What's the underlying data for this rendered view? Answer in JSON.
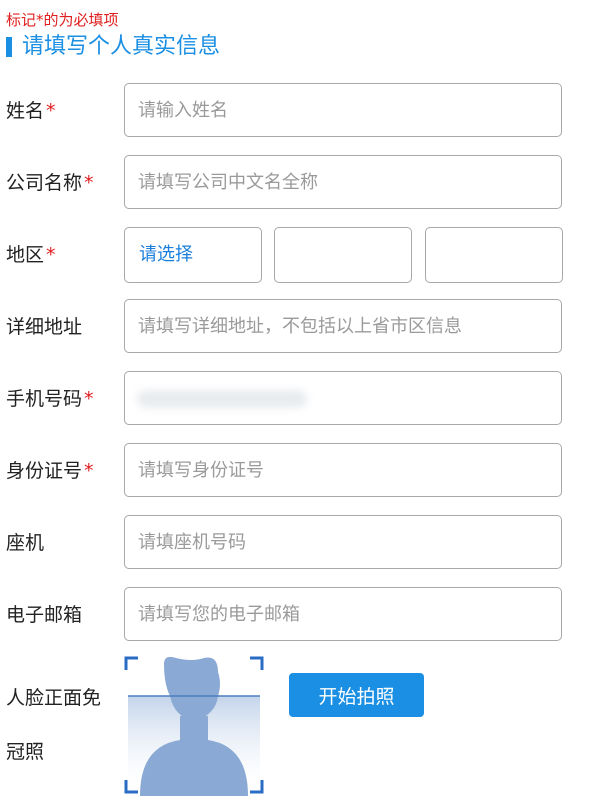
{
  "notice": "标记*的为必填项",
  "section_title": "请填写个人真实信息",
  "fields": [
    {
      "label": "姓名",
      "required": "*",
      "placeholder": "请输入姓名",
      "value": ""
    },
    {
      "label": "公司名称",
      "required": "*",
      "placeholder": "请填写公司中文名全称",
      "value": ""
    },
    {
      "label": "地区",
      "required": "*",
      "select_text": "请选择"
    },
    {
      "label": "详细地址",
      "required": "",
      "placeholder": "请填写详细地址，不包括以上省市区信息",
      "value": ""
    },
    {
      "label": "手机号码",
      "required": "*",
      "placeholder": "",
      "value": ""
    },
    {
      "label": "身份证号",
      "required": "*",
      "placeholder": "请填写身份证号",
      "value": ""
    },
    {
      "label": "座机",
      "required": "",
      "placeholder": "请填座机号码",
      "value": ""
    },
    {
      "label": "电子邮箱",
      "required": "",
      "placeholder": "请填写您的电子邮箱",
      "value": ""
    }
  ],
  "face_photo": {
    "label_line1": "人脸正面免",
    "label_line2": "冠照",
    "button": "开始拍照"
  },
  "colors": {
    "accent": "#1a8fe3",
    "required": "#e02020",
    "select_text": "#1a7fdc",
    "border": "#a8a8a8",
    "placeholder": "#9a9a9a"
  },
  "icons": {
    "face_placeholder": "person-silhouette-icon"
  }
}
